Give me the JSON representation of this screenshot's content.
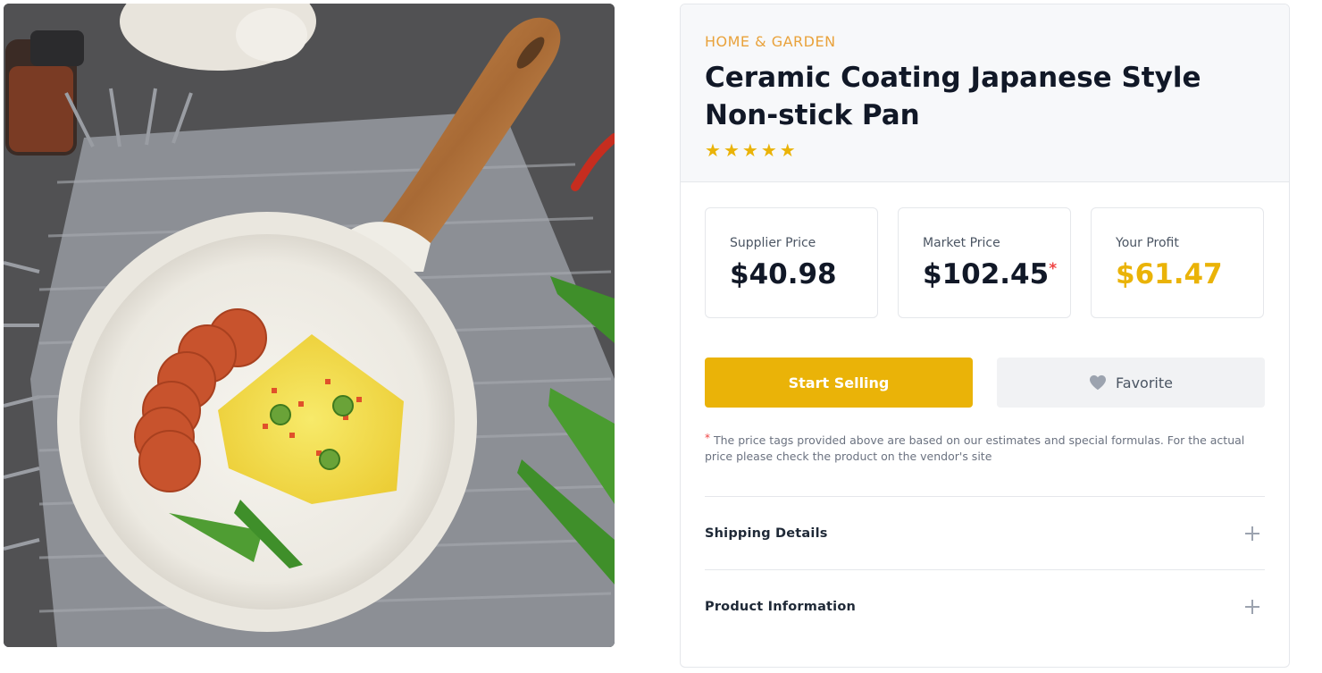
{
  "product": {
    "category": "HOME & GARDEN",
    "title": "Ceramic Coating Japanese Style Non-stick Pan",
    "rating": 5,
    "image_icon": "frying-pan-photo"
  },
  "prices": {
    "supplier": {
      "label": "Supplier Price",
      "value": "$40.98"
    },
    "market": {
      "label": "Market Price",
      "value": "$102.45",
      "marker": "*"
    },
    "profit": {
      "label": "Your Profit",
      "value": "$61.47"
    }
  },
  "actions": {
    "start_selling": "Start Selling",
    "favorite": "Favorite",
    "favorite_icon": "heart-icon"
  },
  "note": {
    "marker": "*",
    "text": "The price tags provided above are based on our estimates and special formulas. For the actual price please check the product on the vendor's site"
  },
  "accordion": {
    "shipping": "Shipping Details",
    "product_info": "Product Information",
    "expand_icon": "plus-icon"
  },
  "colors": {
    "accent": "#eab308",
    "category": "#e9a23b",
    "asterisk": "#ef4444"
  }
}
